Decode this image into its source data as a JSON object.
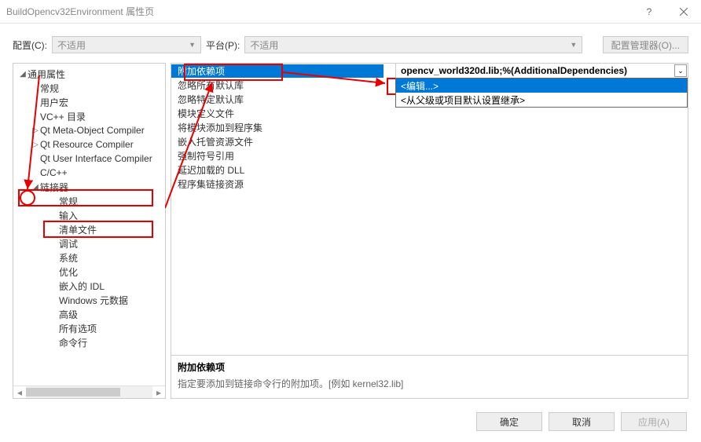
{
  "title": "BuildOpencv32Environment 属性页",
  "toolbar": {
    "config_label": "配置(C):",
    "config_value": "不适用",
    "platform_label": "平台(P):",
    "platform_value": "不适用",
    "manager_btn": "配置管理器(O)..."
  },
  "tree": {
    "root": "通用属性",
    "items_d1": [
      "常规",
      "用户宏",
      "VC++ 目录",
      "Qt Meta-Object Compiler",
      "Qt Resource Compiler",
      "Qt User Interface Compiler",
      "C/C++"
    ],
    "linker": "链接器",
    "linker_children": [
      "常规",
      "输入",
      "清单文件",
      "调试",
      "系统",
      "优化",
      "嵌入的 IDL",
      "Windows 元数据",
      "高级",
      "所有选项",
      "命令行"
    ]
  },
  "props": {
    "rows": [
      "附加依赖项",
      "忽略所有默认库",
      "忽略特定默认库",
      "模块定义文件",
      "将模块添加到程序集",
      "嵌入托管资源文件",
      "强制符号引用",
      "延迟加载的 DLL",
      "程序集链接资源"
    ],
    "value": "opencv_world320d.lib;%(AdditionalDependencies)",
    "dropdown": {
      "edit": "<编辑...>",
      "inherit": "<从父级或项目默认设置继承>"
    }
  },
  "desc": {
    "title": "附加依赖项",
    "body": "指定要添加到链接命令行的附加项。[例如 kernel32.lib]"
  },
  "footer": {
    "ok": "确定",
    "cancel": "取消",
    "apply": "应用(A)"
  }
}
